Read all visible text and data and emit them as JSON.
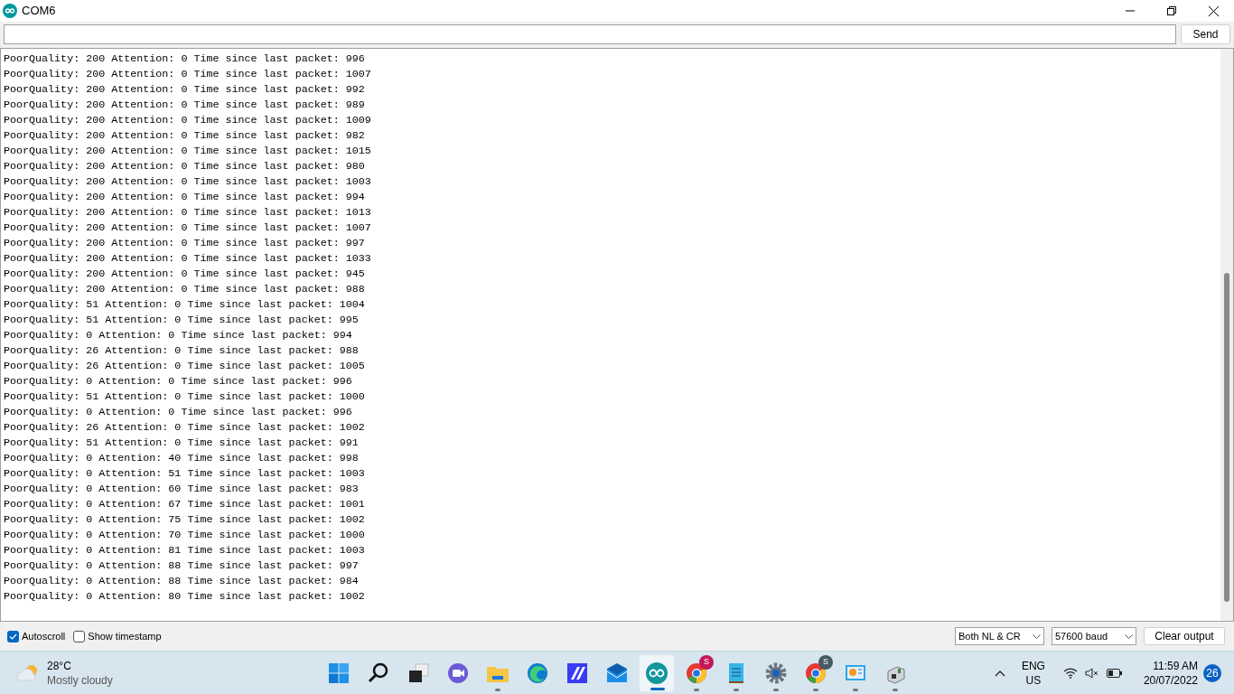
{
  "window": {
    "title": "COM6"
  },
  "send_button": "Send",
  "output_lines": [
    "PoorQuality: 200 Attention: 0 Time since last packet: 996",
    "PoorQuality: 200 Attention: 0 Time since last packet: 1007",
    "PoorQuality: 200 Attention: 0 Time since last packet: 992",
    "PoorQuality: 200 Attention: 0 Time since last packet: 989",
    "PoorQuality: 200 Attention: 0 Time since last packet: 1009",
    "PoorQuality: 200 Attention: 0 Time since last packet: 982",
    "PoorQuality: 200 Attention: 0 Time since last packet: 1015",
    "PoorQuality: 200 Attention: 0 Time since last packet: 980",
    "PoorQuality: 200 Attention: 0 Time since last packet: 1003",
    "PoorQuality: 200 Attention: 0 Time since last packet: 994",
    "PoorQuality: 200 Attention: 0 Time since last packet: 1013",
    "PoorQuality: 200 Attention: 0 Time since last packet: 1007",
    "PoorQuality: 200 Attention: 0 Time since last packet: 997",
    "PoorQuality: 200 Attention: 0 Time since last packet: 1033",
    "PoorQuality: 200 Attention: 0 Time since last packet: 945",
    "PoorQuality: 200 Attention: 0 Time since last packet: 988",
    "PoorQuality: 51 Attention: 0 Time since last packet: 1004",
    "PoorQuality: 51 Attention: 0 Time since last packet: 995",
    "PoorQuality: 0 Attention: 0 Time since last packet: 994",
    "PoorQuality: 26 Attention: 0 Time since last packet: 988",
    "PoorQuality: 26 Attention: 0 Time since last packet: 1005",
    "PoorQuality: 0 Attention: 0 Time since last packet: 996",
    "PoorQuality: 51 Attention: 0 Time since last packet: 1000",
    "PoorQuality: 0 Attention: 0 Time since last packet: 996",
    "PoorQuality: 26 Attention: 0 Time since last packet: 1002",
    "PoorQuality: 51 Attention: 0 Time since last packet: 991",
    "PoorQuality: 0 Attention: 40 Time since last packet: 998",
    "PoorQuality: 0 Attention: 51 Time since last packet: 1003",
    "PoorQuality: 0 Attention: 60 Time since last packet: 983",
    "PoorQuality: 0 Attention: 67 Time since last packet: 1001",
    "PoorQuality: 0 Attention: 75 Time since last packet: 1002",
    "PoorQuality: 0 Attention: 70 Time since last packet: 1000",
    "PoorQuality: 0 Attention: 81 Time since last packet: 1003",
    "PoorQuality: 0 Attention: 88 Time since last packet: 997",
    "PoorQuality: 0 Attention: 88 Time since last packet: 984",
    "PoorQuality: 0 Attention: 80 Time since last packet: 1002"
  ],
  "options": [
    {
      "label": "Autoscroll",
      "checked": true
    },
    {
      "label": "Show timestamp",
      "checked": false
    }
  ],
  "line_ending": "Both NL & CR",
  "baud_rate": "57600 baud",
  "clear_button": "Clear output",
  "taskbar": {
    "weather": {
      "temperature": "28°C",
      "condition": "Mostly cloudy"
    },
    "apps": [
      {
        "kind": "start",
        "running": false,
        "active": false
      },
      {
        "kind": "search",
        "running": false,
        "active": false
      },
      {
        "kind": "taskview",
        "running": false,
        "active": false
      },
      {
        "kind": "chat",
        "running": false,
        "active": false
      },
      {
        "kind": "files",
        "running": true,
        "active": false
      },
      {
        "kind": "edge",
        "running": false,
        "active": false
      },
      {
        "kind": "editor",
        "running": false,
        "active": false
      },
      {
        "kind": "mail",
        "running": false,
        "active": false
      },
      {
        "kind": "arduino",
        "running": true,
        "active": true
      },
      {
        "kind": "chrome",
        "running": true,
        "active": false,
        "badge": "S",
        "color": "#c2185b"
      },
      {
        "kind": "notepad",
        "running": true,
        "active": false
      },
      {
        "kind": "settings",
        "running": true,
        "active": false
      },
      {
        "kind": "chrome",
        "running": true,
        "active": false,
        "badge": "S",
        "color": "#455a64"
      },
      {
        "kind": "controlpanel",
        "running": true,
        "active": false
      },
      {
        "kind": "device",
        "running": true,
        "active": false
      }
    ],
    "language": [
      "ENG",
      "US"
    ],
    "time": "11:59 AM",
    "date": "20/07/2022",
    "notifications": "26"
  }
}
